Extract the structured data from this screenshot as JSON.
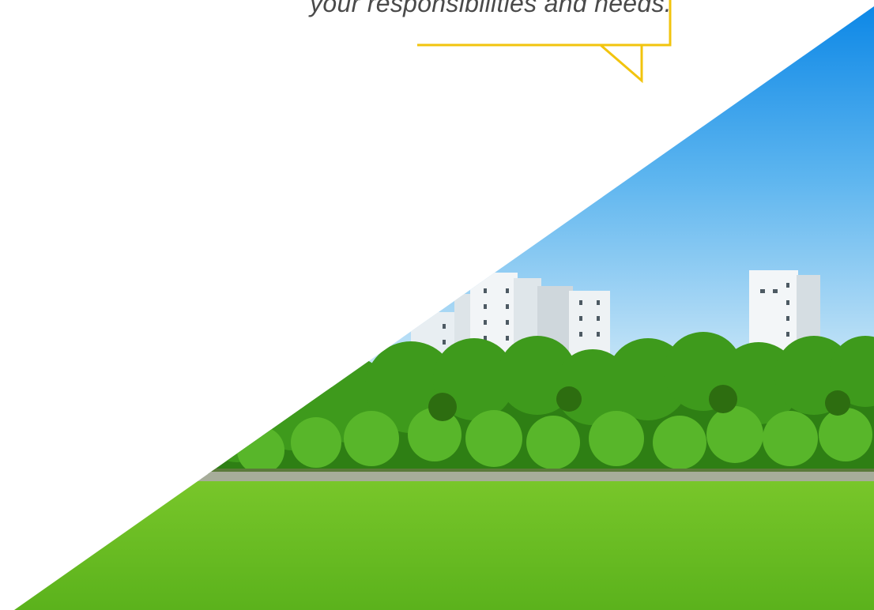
{
  "callout": {
    "text": "your responsibilities and needs."
  },
  "photo": {
    "subject": "apartment-buildings-behind-trees-and-lawn"
  },
  "colors": {
    "accent_yellow": "#F2C40E",
    "sky_top": "#0a86e6",
    "sky_bottom": "#d6ecf8",
    "lawn": "#6cc02a",
    "trees": "#3e9a1c",
    "text": "#4a4a4a"
  }
}
